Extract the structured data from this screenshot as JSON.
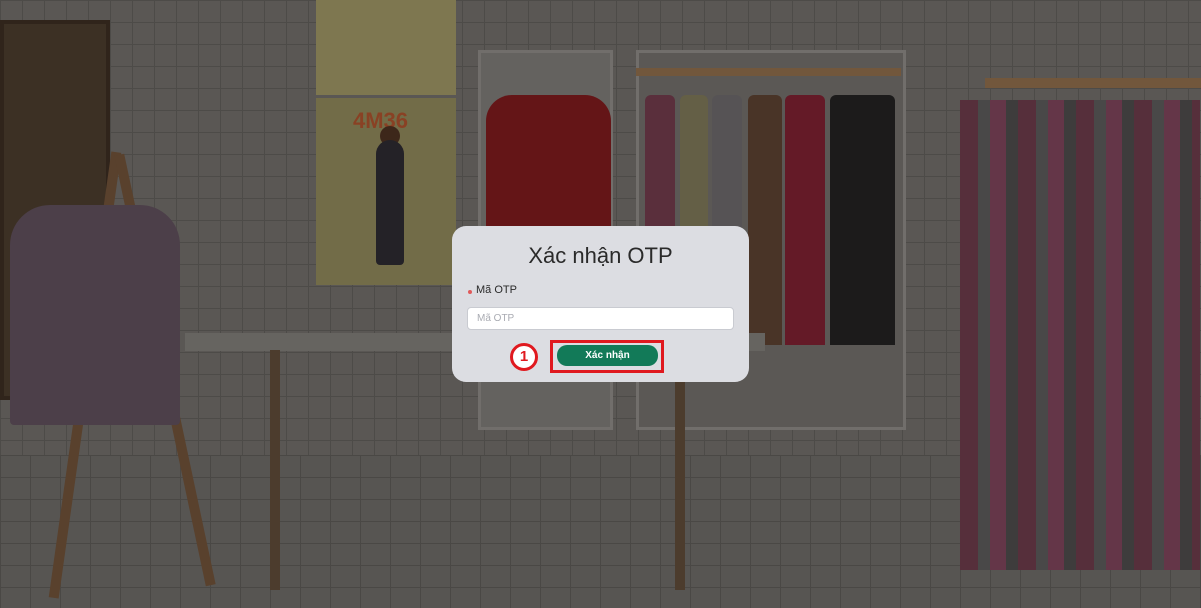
{
  "modal": {
    "title": "Xác nhận OTP",
    "otp_field": {
      "label": "Mã OTP",
      "placeholder": "Mã OTP",
      "value": "",
      "required": true
    },
    "confirm_button_label": "Xác nhận"
  },
  "annotation": {
    "step_number": "1",
    "highlight_color": "#e0191f"
  },
  "background": {
    "poster_text": "4M36"
  },
  "colors": {
    "modal_bg": "#dcdde2",
    "primary_button": "#127a58",
    "required_mark": "#e05a5a"
  }
}
